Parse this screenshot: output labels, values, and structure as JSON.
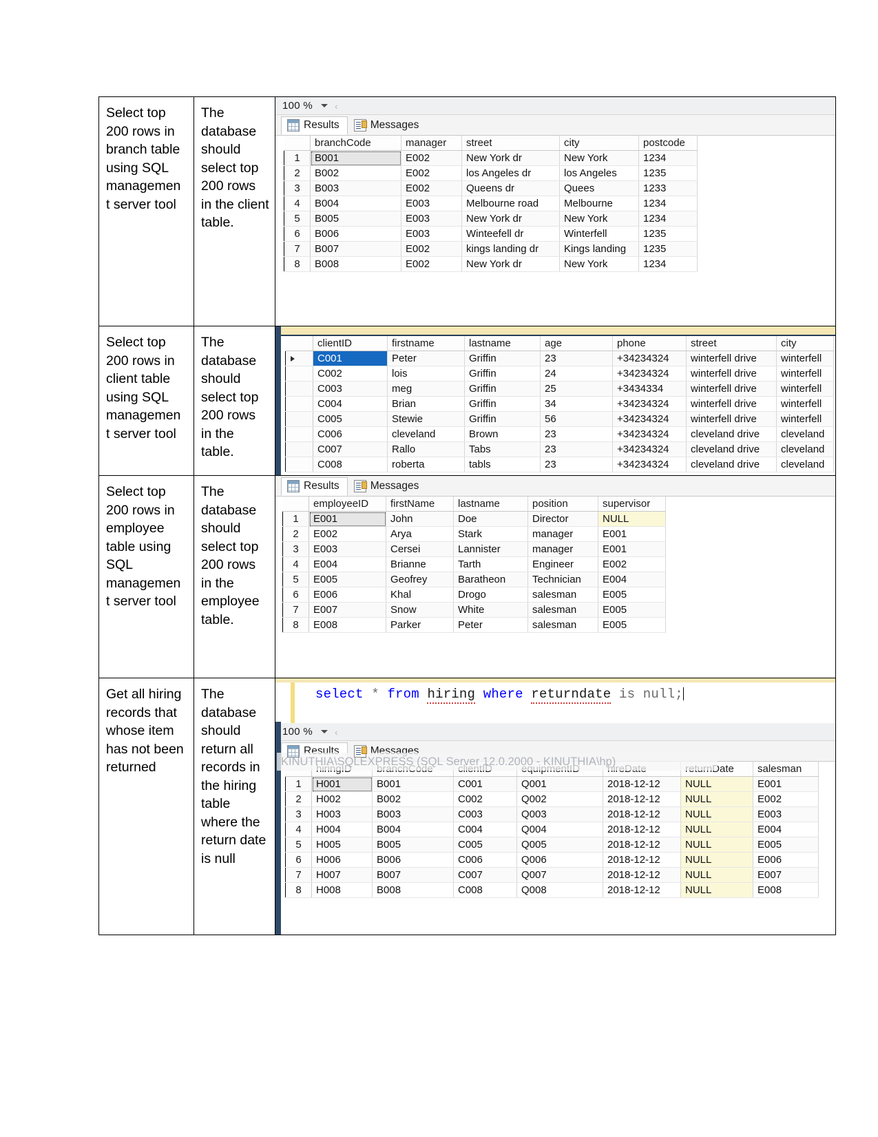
{
  "document": {
    "rows": [
      {
        "requirement": "Select top 200 rows in branch table using SQL managemen t server tool",
        "description": "The database should select top 200 rows in the client table."
      },
      {
        "requirement": "Select top 200 rows in client table using SQL managemen t server tool",
        "description": "The database should select top 200 rows in the table."
      },
      {
        "requirement": "Select top 200 rows in employee table using SQL managemen t server tool",
        "description": "The database should select top 200 rows in the employee table."
      },
      {
        "requirement": "Get all hiring records that whose item has not been returned",
        "description": "The database should return all records in the hiring table where the return date is null"
      }
    ]
  },
  "ssms": {
    "zoom_label": "100 %",
    "tabs": {
      "results": "Results",
      "messages": "Messages"
    },
    "connection_status": "KINUTHIA\\SQLEXPRESS (SQL Server 12.0.2000 - KINUTHIA\\hp)",
    "query": {
      "keyword_select": "select",
      "star": "*",
      "keyword_from": "from",
      "table": "hiring",
      "keyword_where": "where",
      "column": "returndate",
      "tail": "is null;",
      "full_text": "select * from hiring where returndate is null;"
    }
  },
  "colors": {
    "null_highlight": "#fbf8d8",
    "selected_cell": "#e6e6e6",
    "selected_cell_blue": "#1669c1",
    "keyword_blue": "#0000ff",
    "panel_border": "#2e4a69",
    "accent_yellow": "#f6e7b5"
  },
  "branch_grid": {
    "headers": [
      "branchCode",
      "manager",
      "street",
      "city",
      "postcode"
    ],
    "rows": [
      [
        "1",
        "B001",
        "E002",
        "New York dr",
        "New York",
        "1234"
      ],
      [
        "2",
        "B002",
        "E002",
        "los Angeles dr",
        "los Angeles",
        "1235"
      ],
      [
        "3",
        "B003",
        "E002",
        "Queens dr",
        "Quees",
        "1233"
      ],
      [
        "4",
        "B004",
        "E003",
        "Melbourne road",
        "Melbourne",
        "1234"
      ],
      [
        "5",
        "B005",
        "E003",
        "New York dr",
        "New York",
        "1234"
      ],
      [
        "6",
        "B006",
        "E003",
        "Winteefell dr",
        "Winterfell",
        "1235"
      ],
      [
        "7",
        "B007",
        "E002",
        "kings landing dr",
        "Kings landing",
        "1235"
      ],
      [
        "8",
        "B008",
        "E002",
        "New York dr",
        "New York",
        "1234"
      ]
    ]
  },
  "client_grid": {
    "headers": [
      "clientID",
      "firstname",
      "lastname",
      "age",
      "phone",
      "street",
      "city"
    ],
    "rows": [
      [
        "C001",
        "Peter",
        "Griffin",
        "23",
        "+34234324",
        "winterfell drive",
        "winterfell"
      ],
      [
        "C002",
        "lois",
        "Griffin",
        "24",
        "+34234324",
        "winterfell drive",
        "winterfell"
      ],
      [
        "C003",
        "meg",
        "Griffin",
        "25",
        "+3434334",
        "winterfell drive",
        "winterfell"
      ],
      [
        "C004",
        "Brian",
        "Griffin",
        "34",
        "+34234324",
        "winterfell drive",
        "winterfell"
      ],
      [
        "C005",
        "Stewie",
        "Griffin",
        "56",
        "+34234324",
        "winterfell drive",
        "winterfell"
      ],
      [
        "C006",
        "cleveland",
        "Brown",
        "23",
        "+34234324",
        "cleveland drive",
        "cleveland"
      ],
      [
        "C007",
        "Rallo",
        "Tabs",
        "23",
        "+34234324",
        "cleveland drive",
        "cleveland"
      ],
      [
        "C008",
        "roberta",
        "tabls",
        "23",
        "+34234324",
        "cleveland drive",
        "cleveland"
      ]
    ]
  },
  "employee_grid": {
    "headers": [
      "employeeID",
      "firstName",
      "lastname",
      "position",
      "supervisor"
    ],
    "rows": [
      [
        "1",
        "E001",
        "John",
        "Doe",
        "Director",
        "NULL"
      ],
      [
        "2",
        "E002",
        "Arya",
        "Stark",
        "manager",
        "E001"
      ],
      [
        "3",
        "E003",
        "Cersei",
        "Lannister",
        "manager",
        "E001"
      ],
      [
        "4",
        "E004",
        "Brianne",
        "Tarth",
        "Engineer",
        "E002"
      ],
      [
        "5",
        "E005",
        "Geofrey",
        "Baratheon",
        "Technician",
        "E004"
      ],
      [
        "6",
        "E006",
        "Khal",
        "Drogo",
        "salesman",
        "E005"
      ],
      [
        "7",
        "E007",
        "Snow",
        "White",
        "salesman",
        "E005"
      ],
      [
        "8",
        "E008",
        "Parker",
        "Peter",
        "salesman",
        "E005"
      ]
    ]
  },
  "hiring_grid": {
    "headers": [
      "hiringID",
      "branchCode",
      "clientID",
      "equipmentID",
      "hireDate",
      "returnDate",
      "salesman"
    ],
    "rows": [
      [
        "1",
        "H001",
        "B001",
        "C001",
        "Q001",
        "2018-12-12",
        "NULL",
        "E001"
      ],
      [
        "2",
        "H002",
        "B002",
        "C002",
        "Q002",
        "2018-12-12",
        "NULL",
        "E002"
      ],
      [
        "3",
        "H003",
        "B003",
        "C003",
        "Q003",
        "2018-12-12",
        "NULL",
        "E003"
      ],
      [
        "4",
        "H004",
        "B004",
        "C004",
        "Q004",
        "2018-12-12",
        "NULL",
        "E004"
      ],
      [
        "5",
        "H005",
        "B005",
        "C005",
        "Q005",
        "2018-12-12",
        "NULL",
        "E005"
      ],
      [
        "6",
        "H006",
        "B006",
        "C006",
        "Q006",
        "2018-12-12",
        "NULL",
        "E006"
      ],
      [
        "7",
        "H007",
        "B007",
        "C007",
        "Q007",
        "2018-12-12",
        "NULL",
        "E007"
      ],
      [
        "8",
        "H008",
        "B008",
        "C008",
        "Q008",
        "2018-12-12",
        "NULL",
        "E008"
      ]
    ]
  }
}
